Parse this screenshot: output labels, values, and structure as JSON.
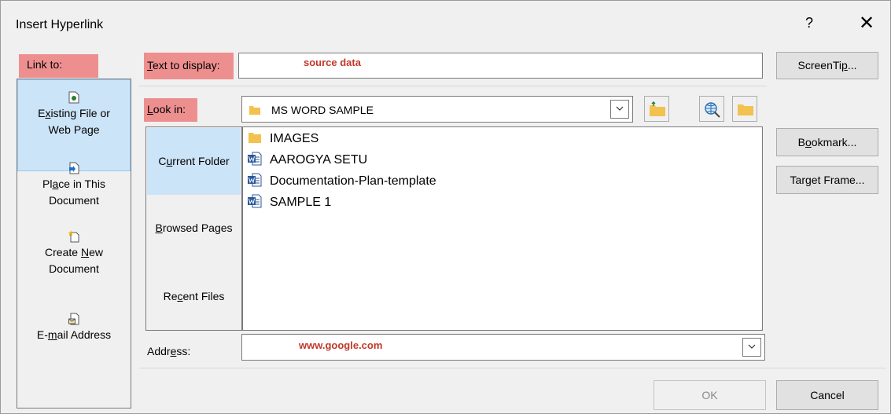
{
  "dialog": {
    "title": "Insert Hyperlink",
    "help": "?",
    "close": "✕"
  },
  "link_to": {
    "label": "Link to:",
    "items": [
      {
        "prefix": "E",
        "underline": "x",
        "rest": "isting File or",
        "line2": "Web Page",
        "icon": "existing-file-icon",
        "selected": true
      },
      {
        "prefix": "Pl",
        "underline": "a",
        "rest": "ce in This",
        "line2": "Document",
        "icon": "place-in-document-icon",
        "selected": false
      },
      {
        "prefix": "Create ",
        "underline": "N",
        "rest": "ew",
        "line2": "Document",
        "icon": "create-new-document-icon",
        "selected": false
      },
      {
        "prefix": "E-",
        "underline": "m",
        "rest": "ail Address",
        "line2": "",
        "icon": "email-address-icon",
        "selected": false
      }
    ]
  },
  "text_to_display": {
    "label_u": "T",
    "label_rest": "ext to display:",
    "value": "",
    "annotation": "source data"
  },
  "screentip_button": {
    "prefix": "ScreenTi",
    "underline": "p",
    "rest": "..."
  },
  "look_in": {
    "label_u": "L",
    "label_rest": "ook in:",
    "value": "MS WORD SAMPLE",
    "tools": [
      "up-one-folder-icon",
      "browse-web-icon",
      "browse-file-icon"
    ]
  },
  "side_tabs": [
    {
      "prefix": "C",
      "underline": "u",
      "rest": "rrent Folder",
      "selected": true
    },
    {
      "prefix": "",
      "underline": "B",
      "rest": "rowsed Pages",
      "selected": false
    },
    {
      "prefix": "Re",
      "underline": "c",
      "rest": "ent Files",
      "selected": false
    }
  ],
  "files": [
    {
      "name": "IMAGES",
      "icon": "folder-icon"
    },
    {
      "name": "AAROGYA SETU",
      "icon": "word-doc-icon"
    },
    {
      "name": "Documentation-Plan-template",
      "icon": "word-doc-icon"
    },
    {
      "name": "SAMPLE 1",
      "icon": "word-doc-icon"
    }
  ],
  "bookmark_button": {
    "prefix": "B",
    "underline": "o",
    "rest": "okmark..."
  },
  "target_frame_button": {
    "prefix": "Tar",
    "underline": "g",
    "rest": "et Frame..."
  },
  "address": {
    "label_prefix": "Addr",
    "label_u": "e",
    "label_rest": "ss:",
    "value": "",
    "annotation": "www.google.com"
  },
  "ok_button": "OK",
  "cancel_button": "Cancel",
  "colors": {
    "highlight": "#ee8f8f",
    "selection": "#cce4f7",
    "annotation": "#c0392b"
  }
}
